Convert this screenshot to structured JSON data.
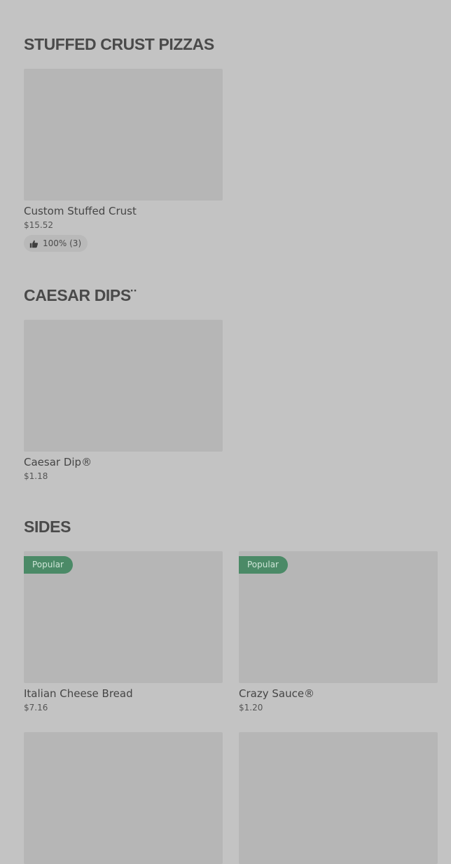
{
  "sections": [
    {
      "title": "STUFFED CRUST PIZZAS",
      "items": [
        {
          "name": "Custom Stuffed Crust",
          "price": "$15.52",
          "rating": "100% (3)"
        }
      ]
    },
    {
      "title": "CAESAR DIPS¨",
      "items": [
        {
          "name": "Caesar Dip®",
          "price": "$1.18"
        }
      ]
    },
    {
      "title": "SIDES",
      "items": [
        {
          "name": "Italian Cheese Bread",
          "price": "$7.16",
          "badge": "Popular"
        },
        {
          "name": "Crazy Sauce®",
          "price": "$1.20",
          "badge": "Popular"
        }
      ]
    }
  ],
  "icons": {
    "rating": "thumbs-up-icon"
  },
  "colors": {
    "background": "#c3c3c3",
    "image_placeholder": "#b6b6b6",
    "badge": "#4b8a67"
  }
}
